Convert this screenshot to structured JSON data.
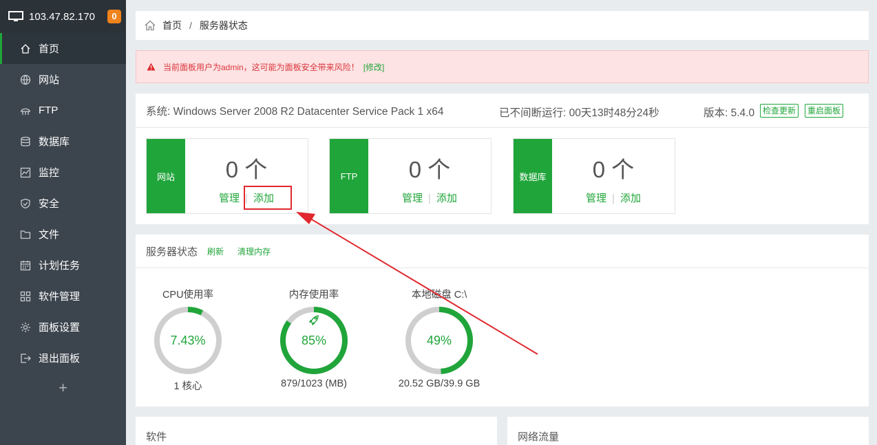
{
  "sidebar": {
    "server_ip": "103.47.82.170",
    "badge": "0",
    "items": [
      {
        "label": "首页",
        "icon": "home-icon"
      },
      {
        "label": "网站",
        "icon": "globe-icon"
      },
      {
        "label": "FTP",
        "icon": "ftp-icon"
      },
      {
        "label": "数据库",
        "icon": "database-icon"
      },
      {
        "label": "监控",
        "icon": "monitor-chart-icon"
      },
      {
        "label": "安全",
        "icon": "shield-icon"
      },
      {
        "label": "文件",
        "icon": "folder-icon"
      },
      {
        "label": "计划任务",
        "icon": "calendar-icon"
      },
      {
        "label": "软件管理",
        "icon": "grid-icon"
      },
      {
        "label": "面板设置",
        "icon": "gear-icon"
      },
      {
        "label": "退出面板",
        "icon": "logout-icon"
      }
    ],
    "plus": "+"
  },
  "breadcrumb": {
    "home": "首页",
    "sep": "/",
    "current": "服务器状态"
  },
  "alert": {
    "message": "当前面板用户为admin，这可能为面板安全带来风险！",
    "fix": "[修改]"
  },
  "overview": {
    "system": "系统: Windows Server 2008 R2 Datacenter Service Pack 1 x64",
    "uptime": "已不间断运行: 00天13时48分24秒",
    "version": "版本: 5.4.0",
    "check_update": "检查更新",
    "restart": "重启面板",
    "cards": [
      {
        "label": "网站",
        "count": "0 个",
        "manage": "管理",
        "add": "添加"
      },
      {
        "label": "FTP",
        "count": "0 个",
        "manage": "管理",
        "add": "添加"
      },
      {
        "label": "数据库",
        "count": "0 个",
        "manage": "管理",
        "add": "添加"
      }
    ]
  },
  "status": {
    "title": "服务器状态",
    "refresh": "刷新",
    "clear_memory": "清理内存",
    "gauges": [
      {
        "title": "CPU使用率",
        "value": "7.43%",
        "percent": 7.43,
        "detail": "1 核心",
        "color": "#20a53a"
      },
      {
        "title": "内存使用率",
        "value": "85%",
        "percent": 85,
        "detail": "879/1023 (MB)",
        "color": "#20a53a"
      },
      {
        "title": "本地磁盘 C:\\",
        "value": "49%",
        "percent": 49,
        "detail": "20.52 GB/39.9 GB",
        "color": "#20a53a"
      }
    ]
  },
  "bottom": {
    "software": "软件",
    "network": "网络流量"
  },
  "colors": {
    "accent": "#20a53a",
    "sidebar": "#3c444d",
    "alert_text": "#d9363e",
    "annotation": "#e0282e"
  }
}
